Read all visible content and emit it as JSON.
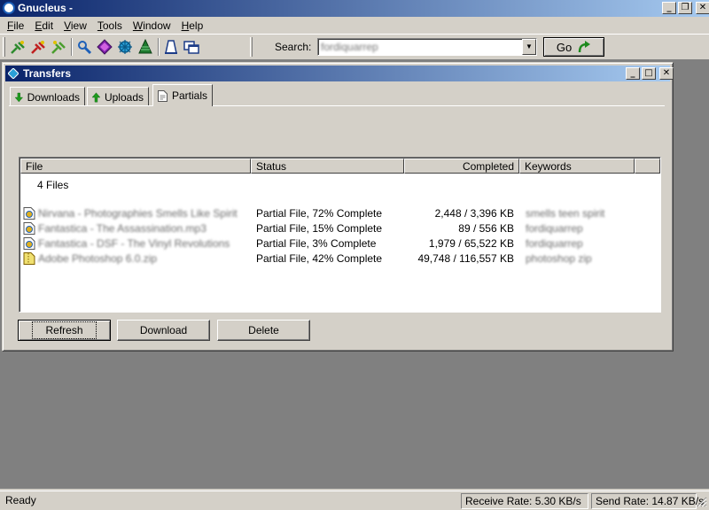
{
  "app": {
    "title": "Gnucleus -"
  },
  "menu": {
    "items": [
      {
        "label": "File",
        "mn": "F",
        "rest": "ile"
      },
      {
        "label": "Edit",
        "mn": "E",
        "rest": "dit"
      },
      {
        "label": "View",
        "mn": "V",
        "rest": "iew"
      },
      {
        "label": "Tools",
        "mn": "T",
        "rest": "ools"
      },
      {
        "label": "Window",
        "mn": "W",
        "rest": "indow"
      },
      {
        "label": "Help",
        "mn": "H",
        "rest": "elp"
      }
    ]
  },
  "toolbar": {
    "search_label": "Search:",
    "search_value": "fordiquarrep",
    "go_label": "Go"
  },
  "transfers": {
    "title": "Transfers",
    "tabs": [
      {
        "label": "Downloads"
      },
      {
        "label": "Uploads"
      },
      {
        "label": "Partials"
      }
    ],
    "columns": [
      "File",
      "Status",
      "Completed",
      "Keywords"
    ],
    "summary": "4 Files",
    "rows": [
      {
        "file": "Nirvana - Photographies Smells Like Spirit",
        "status": "Partial File, 72% Complete",
        "completed": "2,448 / 3,396 KB",
        "keywords": "smells teen spirit"
      },
      {
        "file": "Fantastica - The Assassination.mp3",
        "status": "Partial File, 15% Complete",
        "completed": "89 / 556 KB",
        "keywords": "fordiquarrep"
      },
      {
        "file": "Fantastica - DSF - The Vinyl Revolutions",
        "status": "Partial File, 3% Complete",
        "completed": "1,979 / 65,522 KB",
        "keywords": "fordiquarrep"
      },
      {
        "file": "Adobe Photoshop 6.0.zip",
        "status": "Partial File, 42% Complete",
        "completed": "49,748 / 116,557 KB",
        "keywords": "photoshop zip"
      }
    ],
    "buttons": {
      "refresh": "Refresh",
      "download": "Download",
      "delete": "Delete"
    }
  },
  "statusbar": {
    "state": "Ready",
    "receive": "Receive Rate:  5.30 KB/s",
    "send": "Send Rate:  14.87 KB/s"
  }
}
